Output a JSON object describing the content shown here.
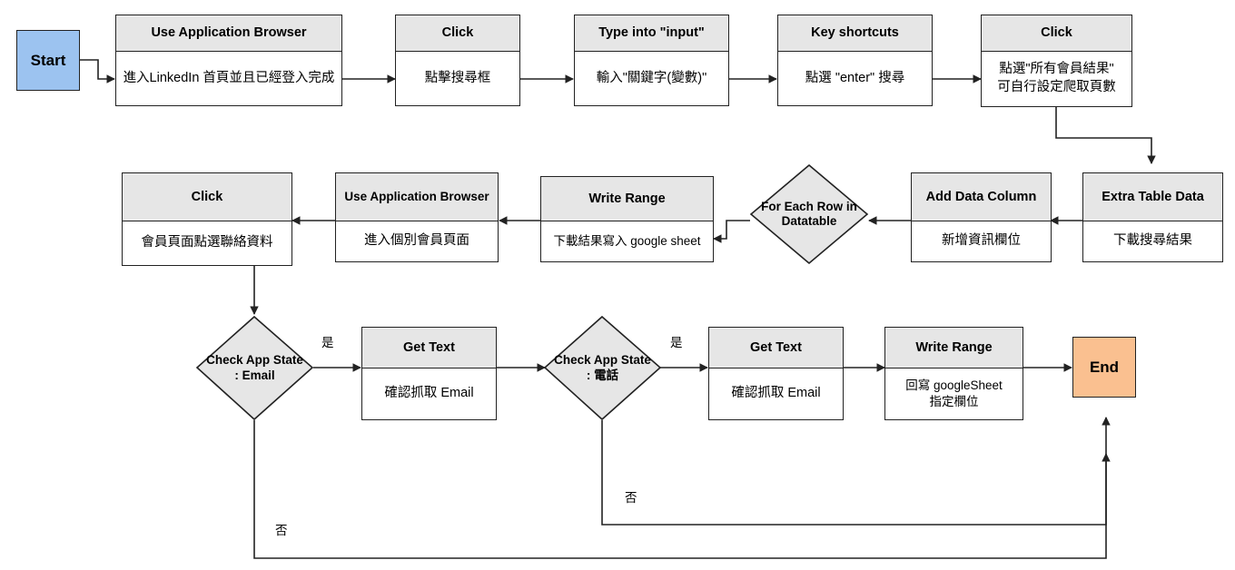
{
  "diagram": {
    "title": "LinkedIn scraping RPA flowchart",
    "colors": {
      "node_header_fill": "#e6e6e6",
      "node_body_fill": "#ffffff",
      "stroke": "#222222",
      "start_fill": "#9cc3f0",
      "end_fill": "#fac090",
      "diamond_fill": "#e6e6e6"
    },
    "terminals": {
      "start": "Start",
      "end": "End"
    },
    "nodes": [
      {
        "id": "use-app-browser-1",
        "header": "Use Application Browser",
        "body": "進入LinkedIn 首頁並且已經登入完成"
      },
      {
        "id": "click-search-box",
        "header": "Click",
        "body": "點擊搜尋框"
      },
      {
        "id": "type-into-input",
        "header": "Type into \"input\"",
        "body": "輸入\"關鍵字(變數)\""
      },
      {
        "id": "key-shortcuts",
        "header": "Key shortcuts",
        "body": "點選 \"enter\" 搜尋"
      },
      {
        "id": "click-all-member-results",
        "header": "Click",
        "body": "點選\"所有會員結果\"\n可自行設定爬取頁數"
      },
      {
        "id": "extra-table-data",
        "header": "Extra Table Data",
        "body": "下載搜尋結果"
      },
      {
        "id": "add-data-column",
        "header": "Add Data Column",
        "body": "新增資訊欄位"
      },
      {
        "id": "write-range-sheet",
        "header": "Write Range",
        "body": "下載結果寫入 google sheet"
      },
      {
        "id": "use-app-browser-2",
        "header": "Use Application Browser",
        "body": "進入個別會員頁面"
      },
      {
        "id": "click-contact-info",
        "header": "Click",
        "body": "會員頁面點選聯絡資料"
      },
      {
        "id": "get-text-email",
        "header": "Get Text",
        "body": "確認抓取 Email"
      },
      {
        "id": "get-text-phone",
        "header": "Get Text",
        "body": "確認抓取 Email"
      },
      {
        "id": "write-range-fields",
        "header": "Write Range",
        "body": "回寫 googleSheet\n指定欄位"
      }
    ],
    "decisions": [
      {
        "id": "for-each-row",
        "label": "For Each Row in\nDatatable"
      },
      {
        "id": "check-app-state-email",
        "label": "Check App State\n: Email"
      },
      {
        "id": "check-app-state-phone",
        "label": "Check App State\n: 電話"
      }
    ],
    "edge_labels": [
      {
        "id": "yes-email",
        "text": "是"
      },
      {
        "id": "yes-phone",
        "text": "是"
      },
      {
        "id": "no-phone",
        "text": "否"
      },
      {
        "id": "no-email",
        "text": "否"
      }
    ]
  }
}
